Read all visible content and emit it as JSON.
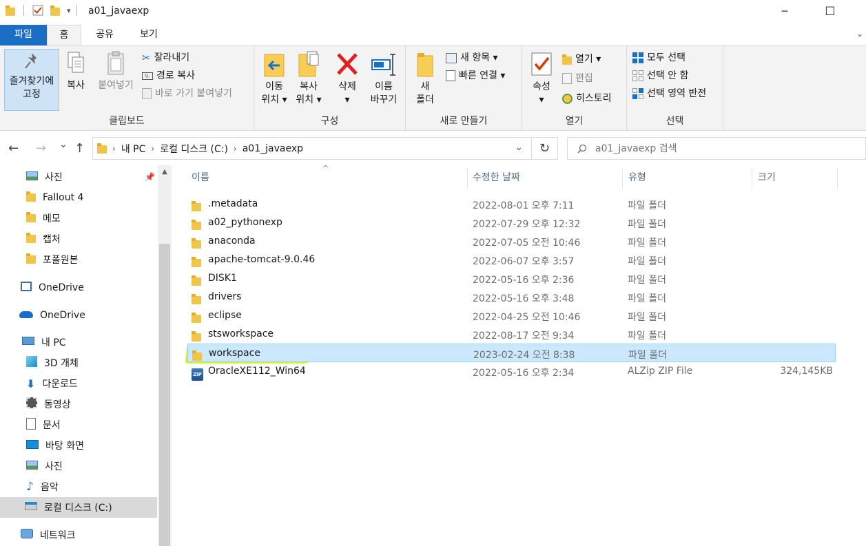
{
  "window": {
    "title": "a01_javaexp",
    "minimize_label": "─",
    "maximize_label": "☐"
  },
  "quick_access": {
    "dropdown_label": "▾"
  },
  "tabs": [
    {
      "label": "파일"
    },
    {
      "label": "홈"
    },
    {
      "label": "공유"
    },
    {
      "label": "보기"
    }
  ],
  "help_chevron": "⌄",
  "ribbon": {
    "clipboard": {
      "label": "클립보드",
      "pin_line1": "즐겨찾기에",
      "pin_line2": "고정",
      "copy": "복사",
      "paste": "붙여넣기",
      "cut": "잘라내기",
      "copy_path": "경로 복사",
      "paste_shortcut": "바로 가기 붙여넣기"
    },
    "organize": {
      "label": "구성",
      "move_line1": "이동",
      "move_line2": "위치 ▾",
      "copyto_line1": "복사",
      "copyto_line2": "위치 ▾",
      "delete_line1": "삭제",
      "delete_line2": "▾",
      "rename_line1": "이름",
      "rename_line2": "바꾸기"
    },
    "new": {
      "label": "새로 만들기",
      "folder_line1": "새",
      "folder_line2": "폴더",
      "new_item": "새 항목 ▾",
      "easy_access": "빠른 연결 ▾"
    },
    "open": {
      "label": "열기",
      "props_line1": "속성",
      "props_line2": "▾",
      "open": "열기 ▾",
      "edit": "편집",
      "history": "히스토리"
    },
    "select": {
      "label": "선택",
      "select_all": "모두 선택",
      "select_none": "선택 안 함",
      "invert": "선택 영역 반전"
    }
  },
  "navigation": {
    "back": "←",
    "forward": "→",
    "recent": "⌄",
    "up": "↑",
    "breadcrumb": [
      "내 PC",
      "로컬 디스크 (C:)",
      "a01_javaexp"
    ],
    "crumb_sep": "›",
    "dropdown": "⌄",
    "refresh": "↻",
    "search_placeholder": "a01_javaexp 검색"
  },
  "sidebar": {
    "scroll_up": "▲",
    "items": [
      {
        "label": "사진",
        "icon": "pictures-icon"
      },
      {
        "label": "Fallout 4",
        "icon": "folder-icon"
      },
      {
        "label": "메모",
        "icon": "folder-icon"
      },
      {
        "label": "캡처",
        "icon": "folder-icon"
      },
      {
        "label": "포폴원본",
        "icon": "folder-icon"
      },
      {
        "label": "OneDrive",
        "icon": "onedrive-square-icon"
      },
      {
        "label": "OneDrive",
        "icon": "cloud-icon"
      },
      {
        "label": "내 PC",
        "icon": "pc-icon"
      },
      {
        "label": "3D 개체",
        "icon": "cube-icon"
      },
      {
        "label": "다운로드",
        "icon": "download-icon"
      },
      {
        "label": "동영상",
        "icon": "video-icon"
      },
      {
        "label": "문서",
        "icon": "document-icon"
      },
      {
        "label": "바탕 화면",
        "icon": "desktop-icon"
      },
      {
        "label": "사진",
        "icon": "pictures-icon"
      },
      {
        "label": "음악",
        "icon": "music-icon"
      },
      {
        "label": "로컬 디스크 (C:)",
        "icon": "drive-icon"
      },
      {
        "label": "네트워크",
        "icon": "network-icon"
      }
    ]
  },
  "columns": {
    "name": "이름",
    "date": "수정한 날짜",
    "type": "유형",
    "size": "크기",
    "sort_indicator": "^"
  },
  "files": [
    {
      "name": ".metadata",
      "date": "2022-08-01 오후 7:11",
      "type": "파일 폴더",
      "size": ""
    },
    {
      "name": "a02_pythonexp",
      "date": "2022-07-29 오후 12:32",
      "type": "파일 폴더",
      "size": ""
    },
    {
      "name": "anaconda",
      "date": "2022-07-05 오전 10:46",
      "type": "파일 폴더",
      "size": ""
    },
    {
      "name": "apache-tomcat-9.0.46",
      "date": "2022-06-07 오후 3:57",
      "type": "파일 폴더",
      "size": ""
    },
    {
      "name": "DISK1",
      "date": "2022-05-16 오후 2:36",
      "type": "파일 폴더",
      "size": ""
    },
    {
      "name": "drivers",
      "date": "2022-05-16 오후 3:48",
      "type": "파일 폴더",
      "size": ""
    },
    {
      "name": "eclipse",
      "date": "2022-04-25 오전 10:46",
      "type": "파일 폴더",
      "size": ""
    },
    {
      "name": "stsworkspace",
      "date": "2022-08-17 오전 9:34",
      "type": "파일 폴더",
      "size": ""
    },
    {
      "name": "workspace",
      "date": "2023-02-24 오전 8:38",
      "type": "파일 폴더",
      "size": ""
    },
    {
      "name": "OracleXE112_Win64",
      "date": "2022-05-16 오후 2:34",
      "type": "ALZip ZIP File",
      "size": "324,145KB"
    }
  ],
  "zip_badge": "ZIP",
  "colors": {
    "accent": "#1a6fc4",
    "selection": "#cce8ff",
    "highlighter": "#d9f200",
    "folder": "#f1c54a"
  }
}
